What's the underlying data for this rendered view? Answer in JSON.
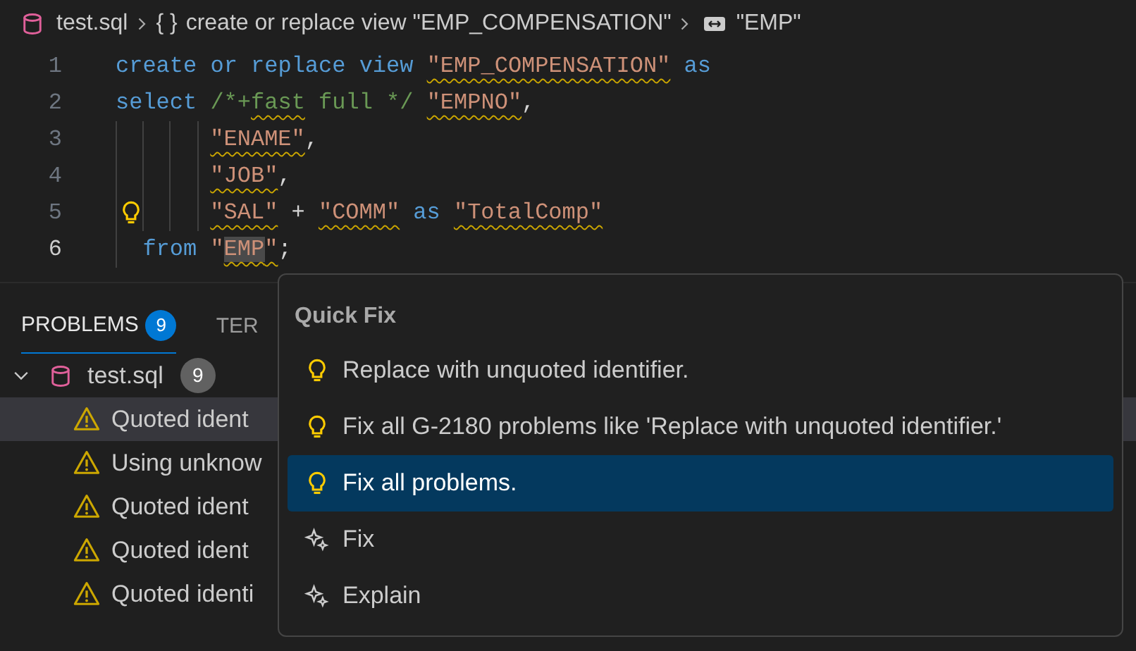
{
  "breadcrumb": [
    {
      "kind": "file",
      "text": "test.sql"
    },
    {
      "kind": "namespace",
      "symbol": "{ }",
      "text": "create or replace view \"EMP_COMPENSATION\""
    },
    {
      "kind": "field",
      "text": "\"EMP\""
    }
  ],
  "code": [
    {
      "number": "1",
      "kind": "statement",
      "current": false,
      "lightbulb": false,
      "tokens": [
        {
          "kind": "keyword",
          "text": "create or replace view",
          "gap": false,
          "squiggle": false,
          "highlight": false
        },
        {
          "kind": "string",
          "text": "\"EMP_COMPENSATION\"",
          "gap": true,
          "squiggle": true,
          "highlight": false
        },
        {
          "kind": "keyword",
          "text": "as",
          "gap": true,
          "squiggle": false,
          "highlight": false
        }
      ]
    },
    {
      "number": "2",
      "kind": "statement",
      "current": false,
      "lightbulb": false,
      "tokens": [
        {
          "kind": "keyword",
          "text": "select",
          "gap": false,
          "squiggle": false,
          "highlight": false
        },
        {
          "kind": "comment",
          "text": "/*+",
          "gap": true,
          "squiggle": false,
          "highlight": false
        },
        {
          "kind": "comment",
          "text": "fast",
          "gap": false,
          "squiggle": true,
          "highlight": false
        },
        {
          "kind": "comment",
          "text": "full */",
          "gap": true,
          "squiggle": false,
          "highlight": false
        },
        {
          "kind": "string",
          "text": "\"EMPNO\"",
          "gap": true,
          "squiggle": true,
          "highlight": false
        },
        {
          "kind": "plain",
          "text": ",",
          "gap": false,
          "squiggle": false,
          "highlight": false
        }
      ]
    },
    {
      "number": "3",
      "kind": "column",
      "current": false,
      "lightbulb": false,
      "tokens": [
        {
          "kind": "string",
          "text": "\"ENAME\"",
          "gap": false,
          "squiggle": true,
          "highlight": false
        },
        {
          "kind": "plain",
          "text": ",",
          "gap": false,
          "squiggle": false,
          "highlight": false
        }
      ]
    },
    {
      "number": "4",
      "kind": "column",
      "current": false,
      "lightbulb": false,
      "tokens": [
        {
          "kind": "string",
          "text": "\"JOB\"",
          "gap": false,
          "squiggle": true,
          "highlight": false
        },
        {
          "kind": "plain",
          "text": ",",
          "gap": false,
          "squiggle": false,
          "highlight": false
        }
      ]
    },
    {
      "number": "5",
      "kind": "column",
      "current": false,
      "lightbulb": true,
      "tokens": [
        {
          "kind": "string",
          "text": "\"SAL\"",
          "gap": false,
          "squiggle": true,
          "highlight": false
        },
        {
          "kind": "plain",
          "text": "+",
          "gap": true,
          "squiggle": false,
          "highlight": false
        },
        {
          "kind": "string",
          "text": "\"COMM\"",
          "gap": true,
          "squiggle": true,
          "highlight": false
        },
        {
          "kind": "keyword",
          "text": "as",
          "gap": true,
          "squiggle": false,
          "highlight": false
        },
        {
          "kind": "string",
          "text": "\"TotalComp\"",
          "gap": true,
          "squiggle": true,
          "highlight": false
        }
      ]
    },
    {
      "number": "6",
      "kind": "clause",
      "current": true,
      "lightbulb": false,
      "tokens": [
        {
          "kind": "keyword",
          "text": "from",
          "gap": false,
          "squiggle": false,
          "highlight": false
        },
        {
          "kind": "string",
          "text": "\"",
          "gap": true,
          "squiggle": false,
          "highlight": false
        },
        {
          "kind": "string",
          "text": "EMP",
          "gap": false,
          "squiggle": true,
          "highlight": true
        },
        {
          "kind": "string",
          "text": "\"",
          "gap": false,
          "squiggle": true,
          "highlight": false
        },
        {
          "kind": "plain",
          "text": ";",
          "gap": false,
          "squiggle": false,
          "highlight": false
        }
      ]
    }
  ],
  "panel": {
    "tabs": [
      {
        "label": "PROBLEMS",
        "badge": "9",
        "selected": true
      },
      {
        "label": "TER",
        "selected": false
      }
    ],
    "file": {
      "name": "test.sql",
      "count": "9",
      "expanded": true,
      "problems": [
        {
          "message": "Quoted ident",
          "selected": true
        },
        {
          "message": "Using unknow",
          "selected": false
        },
        {
          "message": "Quoted ident",
          "selected": false
        },
        {
          "message": "Quoted ident",
          "selected": false
        },
        {
          "message": "Quoted identi",
          "selected": false
        }
      ]
    }
  },
  "quick_fix": {
    "title": "Quick Fix",
    "items": [
      {
        "kind": "lightbulb",
        "label": "Replace with unquoted identifier.",
        "selected": false
      },
      {
        "kind": "lightbulb",
        "label": "Fix all G-2180 problems like 'Replace with unquoted identifier.'",
        "selected": false
      },
      {
        "kind": "lightbulb",
        "label": "Fix all problems.",
        "selected": true
      },
      {
        "kind": "sparkle",
        "label": "Fix",
        "selected": false
      },
      {
        "kind": "sparkle",
        "label": "Explain",
        "selected": false
      }
    ]
  }
}
